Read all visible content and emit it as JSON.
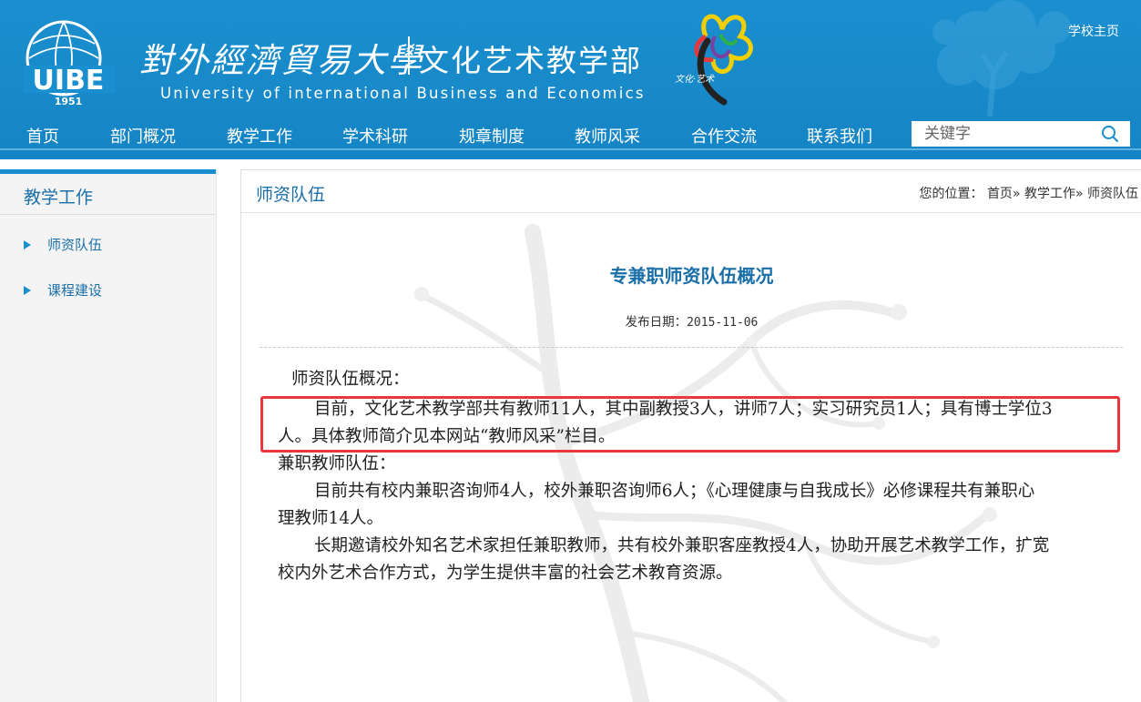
{
  "header": {
    "logo_badge_year": "1951",
    "logo_badge_letters": "UIBE",
    "university_cn": "對外經濟貿易大學",
    "department": "文化艺术教学部",
    "university_en": "University of international Business  and Economics",
    "flower_caption": "文化·艺术",
    "school_home_link": "学校主页",
    "colors": {
      "header_blue": "#1a8fcf",
      "text_blue": "#1a6fa8",
      "highlight_red": "#e8383d"
    }
  },
  "nav": {
    "items": [
      {
        "label": "首页"
      },
      {
        "label": "部门概况"
      },
      {
        "label": "教学工作"
      },
      {
        "label": "学术科研"
      },
      {
        "label": "规章制度"
      },
      {
        "label": "教师风采"
      },
      {
        "label": "合作交流"
      },
      {
        "label": "联系我们"
      }
    ],
    "search": {
      "placeholder": "关键字",
      "icon": "search-icon"
    }
  },
  "sidebar": {
    "title": "教学工作",
    "items": [
      {
        "label": "师资队伍",
        "icon": "triangle-arrow-icon"
      },
      {
        "label": "课程建设",
        "icon": "triangle-arrow-icon"
      }
    ]
  },
  "content": {
    "section_title": "师资队伍",
    "breadcrumb": {
      "prefix": "您的位置：",
      "items": [
        "首页",
        "教学工作",
        "师资队伍"
      ],
      "separator": "»"
    },
    "article": {
      "title": "专兼职师资队伍概况",
      "date_label": "发布日期：",
      "date": "2015-11-06",
      "paragraphs": [
        "师资队伍概况：",
        "目前，文化艺术教学部共有教师11人，其中副教授3人，讲师7人；实习研究员1人；具有博士学位3",
        "人。具体教师简介见本网站“教师风采”栏目。",
        "兼职教师队伍：",
        "目前共有校内兼职咨询师4人，校外兼职咨询师6人；《心理健康与自我成长》必修课程共有兼职心",
        "理教师14人。",
        "长期邀请校外知名艺术家担任兼职教师，共有校外兼职客座教授4人，协助开展艺术教学工作，扩宽",
        "校内外艺术合作方式，为学生提供丰富的社会艺术教育资源。"
      ]
    }
  }
}
